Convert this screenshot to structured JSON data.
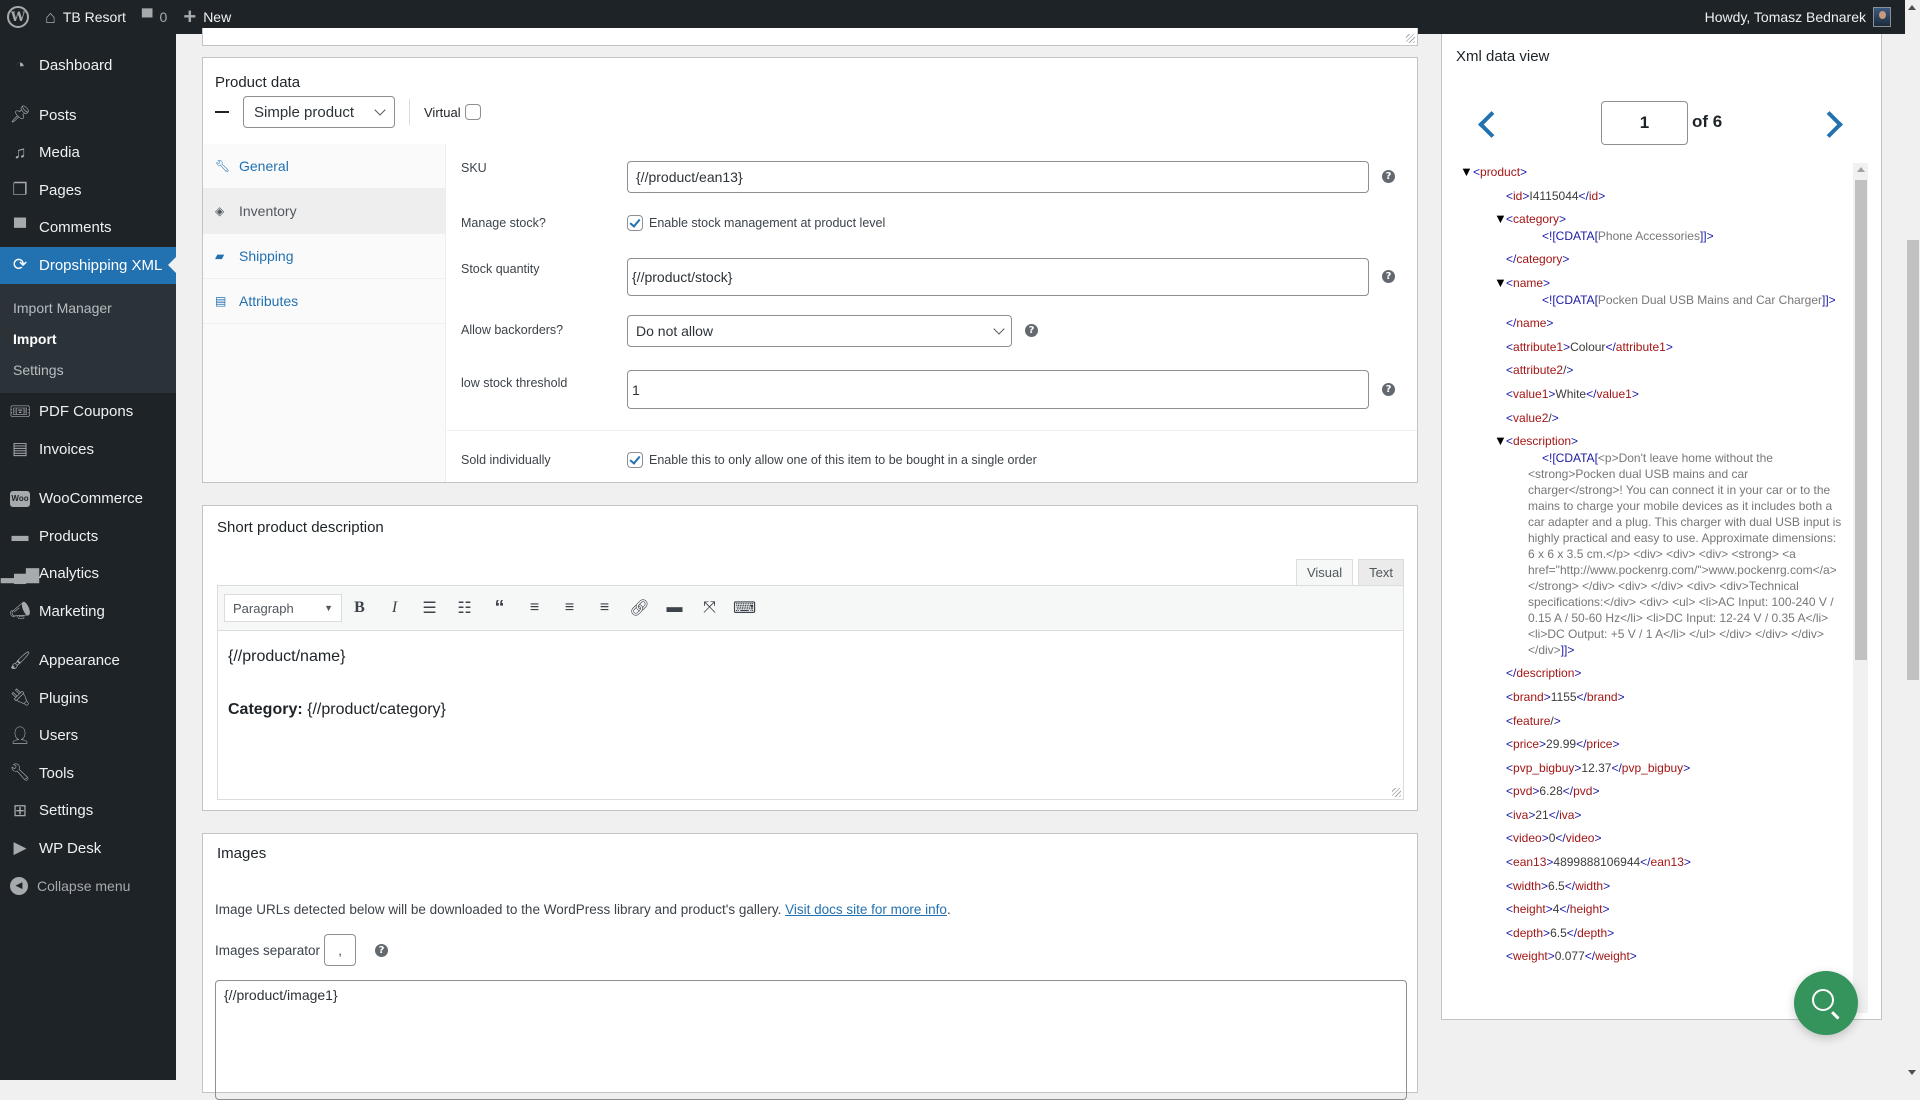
{
  "adminbar": {
    "site_name": "TB Resort",
    "comments_count": "0",
    "new_label": "New",
    "greeting": "Howdy, Tomasz Bednarek"
  },
  "sidebar": {
    "items": [
      {
        "label": "Dashboard",
        "icon": "dashboard-icon"
      },
      {
        "label": "Posts",
        "icon": "pin-icon"
      },
      {
        "label": "Media",
        "icon": "media-icon"
      },
      {
        "label": "Pages",
        "icon": "pages-icon"
      },
      {
        "label": "Comments",
        "icon": "comment-icon"
      },
      {
        "label": "Dropshipping XML",
        "icon": "sync-icon",
        "active": true
      },
      {
        "label": "PDF Coupons",
        "icon": "tickets-icon"
      },
      {
        "label": "Invoices",
        "icon": "invoice-icon"
      },
      {
        "label": "WooCommerce",
        "icon": "woo-icon"
      },
      {
        "label": "Products",
        "icon": "archive-icon"
      },
      {
        "label": "Analytics",
        "icon": "bar-chart-icon"
      },
      {
        "label": "Marketing",
        "icon": "megaphone-icon"
      },
      {
        "label": "Appearance",
        "icon": "brush-icon"
      },
      {
        "label": "Plugins",
        "icon": "plug-icon"
      },
      {
        "label": "Users",
        "icon": "user-icon"
      },
      {
        "label": "Tools",
        "icon": "wrench-icon"
      },
      {
        "label": "Settings",
        "icon": "sliders-icon"
      },
      {
        "label": "WP Desk",
        "icon": "play-icon"
      },
      {
        "label": "Collapse menu",
        "icon": "collapse-icon"
      }
    ],
    "submenu": [
      {
        "label": "Import Manager"
      },
      {
        "label": "Import",
        "current": true
      },
      {
        "label": "Settings"
      }
    ]
  },
  "product_data": {
    "title": "Product data",
    "type_select": "Simple product",
    "virtual_label": "Virtual",
    "virtual_checked": false,
    "tabs": [
      {
        "label": "General",
        "icon": "wrench-icon"
      },
      {
        "label": "Inventory",
        "icon": "tag-icon",
        "active": true
      },
      {
        "label": "Shipping",
        "icon": "truck-icon"
      },
      {
        "label": "Attributes",
        "icon": "list-icon"
      }
    ],
    "fields": {
      "sku": {
        "label": "SKU",
        "value": "{//product/ean13}"
      },
      "manage_stock": {
        "label": "Manage stock?",
        "checkbox_label": "Enable stock management at product level",
        "checked": true
      },
      "stock_quantity": {
        "label": "Stock quantity",
        "value": "{//product/stock}"
      },
      "backorders": {
        "label": "Allow backorders?",
        "value": "Do not allow"
      },
      "low_stock": {
        "label": "low stock threshold",
        "value": "1"
      },
      "sold_individually": {
        "label": "Sold individually",
        "checkbox_label": "Enable this to only allow one of this item to be bought in a single order",
        "checked": true
      }
    }
  },
  "short_description": {
    "title": "Short product description",
    "tab_visual": "Visual",
    "tab_text": "Text",
    "format_select": "Paragraph",
    "toolbar": [
      "bold-icon",
      "italic-icon",
      "bullet-list-icon",
      "numbered-list-icon",
      "blockquote-icon",
      "align-left-icon",
      "align-center-icon",
      "align-right-icon",
      "link-icon",
      "read-more-icon",
      "fullscreen-icon",
      "toolbar-toggle-icon"
    ],
    "content_line1": "{//product/name}",
    "content_label": "Category:",
    "content_value": " {//product/category}"
  },
  "images": {
    "title": "Images",
    "info_text": "Image URLs detected below will be downloaded to the WordPress library and product's gallery. ",
    "info_link": "Visit docs site for more info",
    "info_end": ".",
    "separator_label": "Images separator",
    "separator_value": ",",
    "urls_value": "{//product/image1}"
  },
  "xml_view": {
    "title": "Xml data view",
    "current_page": "1",
    "of_label": "of 6",
    "root": "product",
    "nodes": [
      {
        "tag": "id",
        "text": "I4115044"
      },
      {
        "tag": "category",
        "cdata": "Phone Accessories"
      },
      {
        "tag": "name",
        "cdata": "Pocken Dual USB Mains and Car Charger"
      },
      {
        "tag": "attribute1",
        "text": "Colour"
      },
      {
        "tag": "attribute2",
        "empty": true
      },
      {
        "tag": "value1",
        "text": "White"
      },
      {
        "tag": "value2",
        "empty": true
      },
      {
        "tag": "description",
        "cdata": "<p>Don't leave home without the <strong>Pocken dual USB mains and car charger</strong>! You can connect it in your car or to the mains to charge your mobile devices as it includes both a car adapter and a plug. This charger with dual USB input is highly practical and easy to use. Approximate dimensions: 6 x 6 x 3.5 cm.</p> <div> <div> <div> <strong> <a href=\"http://www.pockenrg.com/\">www.pockenrg.com</a> </strong> </div> <div>  </div> <div> <div>Technical specifications:</div> <div> <ul> <li>AC Input: 100-240 V / 0.15 A / 50-60 Hz</li> <li>DC Input: 12-24 V / 0.35 A</li> <li>DC Output: +5 V / 1 A</li> </ul> </div> </div> </div> </div>"
      },
      {
        "tag": "brand",
        "text": "1155"
      },
      {
        "tag": "feature",
        "empty": true
      },
      {
        "tag": "price",
        "text": "29.99"
      },
      {
        "tag": "pvp_bigbuy",
        "text": "12.37"
      },
      {
        "tag": "pvd",
        "text": "6.28"
      },
      {
        "tag": "iva",
        "text": "21"
      },
      {
        "tag": "video",
        "text": "0"
      },
      {
        "tag": "ean13",
        "text": "4899888106944"
      },
      {
        "tag": "width",
        "text": "6.5"
      },
      {
        "tag": "height",
        "text": "4"
      },
      {
        "tag": "depth",
        "text": "6.5"
      },
      {
        "tag": "weight",
        "text": "0.077"
      }
    ]
  },
  "help_button": {
    "icon": "search-icon"
  }
}
